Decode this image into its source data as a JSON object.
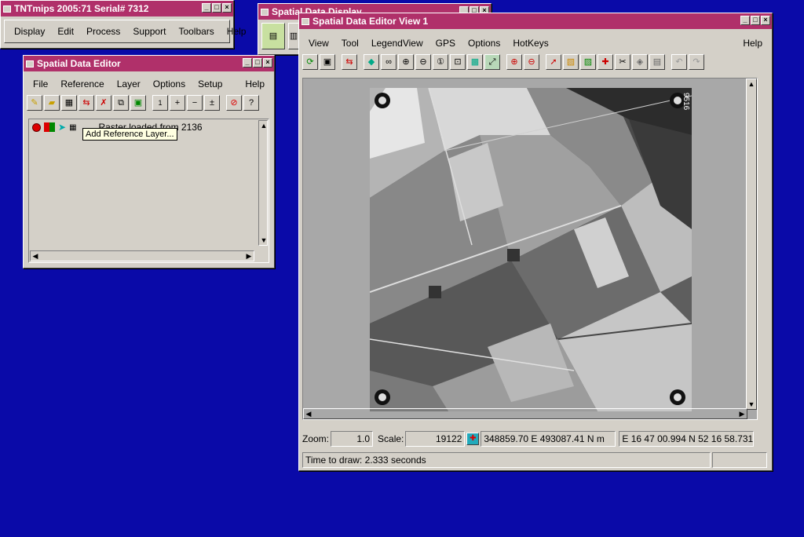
{
  "main_window": {
    "title": "TNTmips 2005:71  Serial# 7312",
    "menu": [
      "Display",
      "Edit",
      "Process",
      "Support",
      "Toolbars",
      "Help"
    ]
  },
  "display_window": {
    "title": "Spatial Data Display"
  },
  "editor_window": {
    "title": "Spatial Data Editor",
    "menu": [
      "File",
      "Reference",
      "Layer",
      "Options",
      "Setup"
    ],
    "help": "Help",
    "layer_text": "Raster loaded from 2136",
    "tooltip": "Add Reference Layer..."
  },
  "view_window": {
    "title": "Spatial Data Editor View 1",
    "menu": [
      "View",
      "Tool",
      "LegendView",
      "GPS",
      "Options",
      "HotKeys"
    ],
    "help": "Help",
    "status": {
      "zoom_label": "Zoom:",
      "zoom_value": "1.0",
      "scale_label": "Scale:",
      "scale_value": "19122",
      "coords_map": "348859.70 E  493087.41 N m",
      "coords_geo": "E 16 47 00.994  N 52 16 58.731",
      "draw_time": "Time to draw: 2.333 seconds"
    },
    "photo_label": "9516"
  },
  "colors": {
    "desktop": "#0a0aa8",
    "titlebar": "#b0306a",
    "panel": "#d4d0c8",
    "tooltip_bg": "#ffffe1"
  }
}
